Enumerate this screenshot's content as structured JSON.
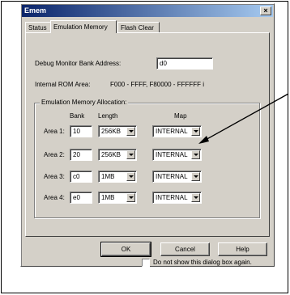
{
  "dialog": {
    "title": "Emem",
    "close_glyph": "×"
  },
  "tabs": [
    {
      "label": "Status",
      "active": false
    },
    {
      "label": "Emulation Memory",
      "active": true
    },
    {
      "label": "Flash Clear",
      "active": false
    }
  ],
  "panel": {
    "debug_monitor_label": "Debug Monitor Bank Address:",
    "debug_monitor_value": "d0",
    "internal_rom_label": "Internal ROM Area:",
    "internal_rom_value": "F000 - FFFF, F80000 - FFFFFF i",
    "group_label": "Emulation Memory Allocation:",
    "columns": {
      "bank": "Bank",
      "length": "Length",
      "map": "Map"
    },
    "areas": [
      {
        "label": "Area 1:",
        "bank": "10",
        "length": "256KB",
        "map": "INTERNAL"
      },
      {
        "label": "Area 2:",
        "bank": "20",
        "length": "256KB",
        "map": "INTERNAL"
      },
      {
        "label": "Area 3:",
        "bank": "c0",
        "length": "1MB",
        "map": "INTERNAL"
      },
      {
        "label": "Area 4:",
        "bank": "e0",
        "length": "1MB",
        "map": "INTERNAL"
      }
    ]
  },
  "buttons": {
    "ok": "OK",
    "cancel": "Cancel",
    "help": "Help"
  },
  "checkbox": {
    "label": "Do not show this dialog box again.",
    "checked": false
  },
  "icons": {
    "close": "close-icon",
    "dropdown": "chevron-down-icon"
  },
  "colors": {
    "title_start": "#0a246a",
    "title_end": "#a6caf0",
    "face": "#d4d0c8"
  }
}
